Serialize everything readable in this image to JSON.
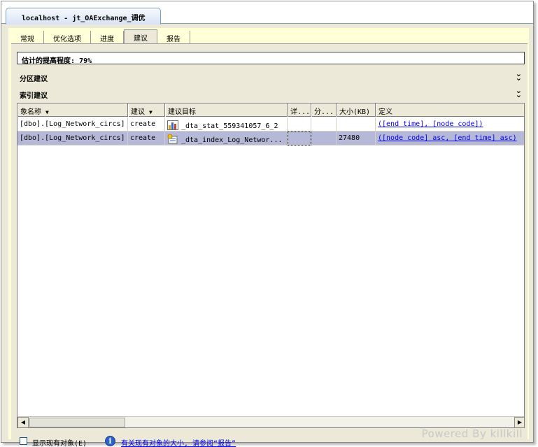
{
  "window": {
    "doc_tab_title": "localhost - jt_OAExchange_调优"
  },
  "tabs": [
    {
      "label": "常规",
      "active": false
    },
    {
      "label": "优化选项",
      "active": false
    },
    {
      "label": "进度",
      "active": false
    },
    {
      "label": "建议",
      "active": true
    },
    {
      "label": "报告",
      "active": false
    }
  ],
  "improvement": {
    "label": "估计的提高程度:",
    "value": "79%"
  },
  "sections": {
    "partition": "分区建议",
    "index": "索引建议"
  },
  "grid": {
    "columns": [
      {
        "label": "象名称",
        "sort": "▼"
      },
      {
        "label": "建议",
        "sort": "▼"
      },
      {
        "label": "建议目标",
        "sort": ""
      },
      {
        "label": "详...",
        "sort": ""
      },
      {
        "label": "分...",
        "sort": ""
      },
      {
        "label": "大小(KB)",
        "sort": ""
      },
      {
        "label": "定义",
        "sort": ""
      }
    ],
    "rows": [
      {
        "object": "[dbo].[Log_Network_circs]",
        "recommendation": "create",
        "target_icon": "statistics-icon",
        "target": "_dta_stat_559341057_6_2",
        "details": "",
        "partition": "",
        "size": "",
        "definition": "([end time], [node code])",
        "selected": false
      },
      {
        "object": "[dbo].[Log_Network_circs]",
        "recommendation": "create",
        "target_icon": "index-icon",
        "target": "_dta_index_Log_Networ...",
        "details": "",
        "partition": "",
        "size": "27480",
        "definition": "([node code] asc, [end time] asc)",
        "selected": true
      }
    ]
  },
  "footer": {
    "checkbox_label": "显示现有对象(E)",
    "info_link": "有关现有对象的大小, 请参阅“报告”"
  },
  "watermark": "Powered By killkill"
}
